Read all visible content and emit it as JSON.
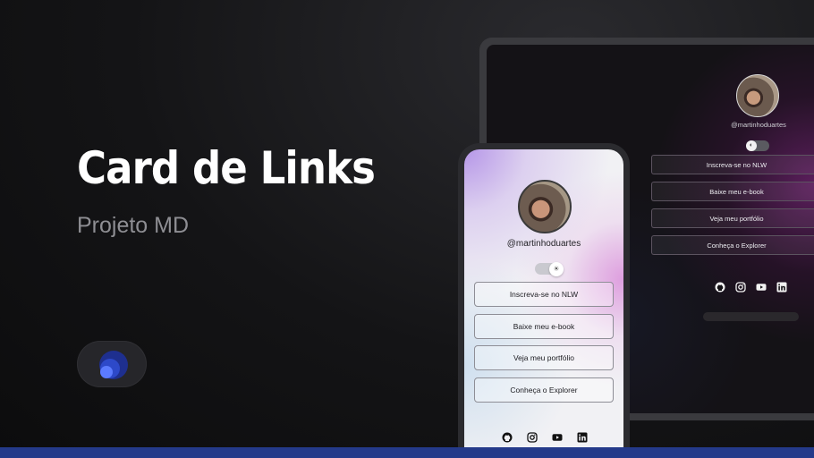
{
  "hero": {
    "title": "Card de Links",
    "subtitle": "Projeto MD"
  },
  "profile": {
    "handle": "@martinhoduartes"
  },
  "links": [
    "Inscreva-se no NLW",
    "Baixe meu e-book",
    "Veja meu portfólio",
    "Conheça o Explorer"
  ],
  "socials": [
    "github-icon",
    "instagram-icon",
    "youtube-icon",
    "linkedin-icon"
  ],
  "colors": {
    "background": "#141416",
    "bottom_bar": "#243a8a",
    "accent_purple": "#9b2aa0",
    "logo_blue": "#3b5cf0"
  }
}
